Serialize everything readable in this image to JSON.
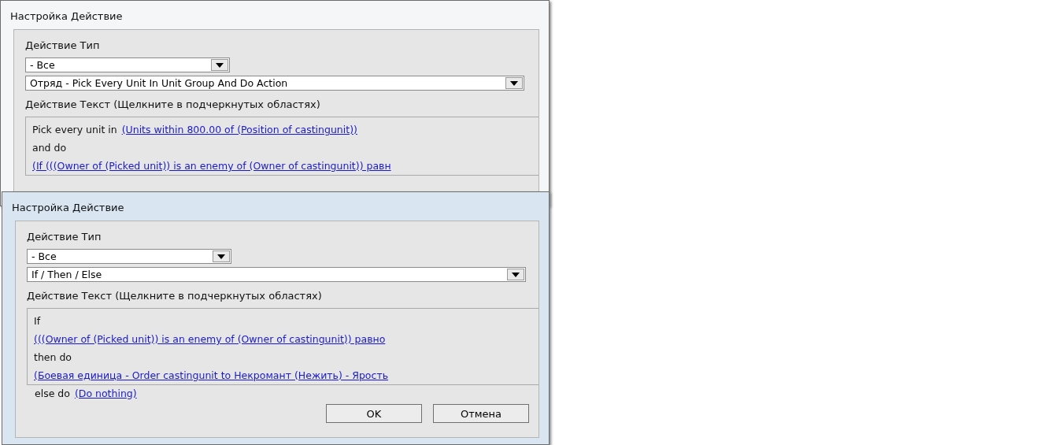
{
  "dialogs": [
    {
      "title": "Настройка Действие",
      "type_label": "Действие Тип",
      "category": "- Все",
      "action": "Отряд - Pick Every Unit In Unit Group And Do Action",
      "text_label": "Действие Текст (Щелкните в подчеркнутых областях)",
      "lines": [
        [
          {
            "kind": "plain",
            "text": "Pick every unit in"
          },
          {
            "kind": "link",
            "text": "(Units within 800.00 of (Position of castingunit))"
          }
        ],
        [
          {
            "kind": "plain",
            "text": "and do"
          }
        ],
        [
          {
            "kind": "link",
            "text": "(If (((Owner of (Picked unit)) is an enemy of (Owner of castingunit)) равн"
          }
        ]
      ]
    },
    {
      "title": "Настройка Действие",
      "type_label": "Действие Тип",
      "category": "- Все",
      "action": "If / Then / Else",
      "text_label": "Действие Текст (Щелкните в подчеркнутых областях)",
      "lines": [
        [
          {
            "kind": "plain",
            "text": "If"
          }
        ],
        [
          {
            "kind": "link",
            "text": "(((Owner of (Picked unit)) is an enemy of (Owner of castingunit)) равно"
          }
        ],
        [
          {
            "kind": "plain",
            "text": "then do"
          }
        ],
        [
          {
            "kind": "link",
            "text": "(Боевая единица - Order castingunit to Некромант (Нежить) - Ярость"
          }
        ]
      ],
      "outside_lines": [
        [
          {
            "kind": "plain",
            "text": "else do"
          },
          {
            "kind": "link",
            "text": "(Do nothing)"
          }
        ]
      ],
      "buttons": [
        "OK",
        "Отмена"
      ]
    }
  ]
}
